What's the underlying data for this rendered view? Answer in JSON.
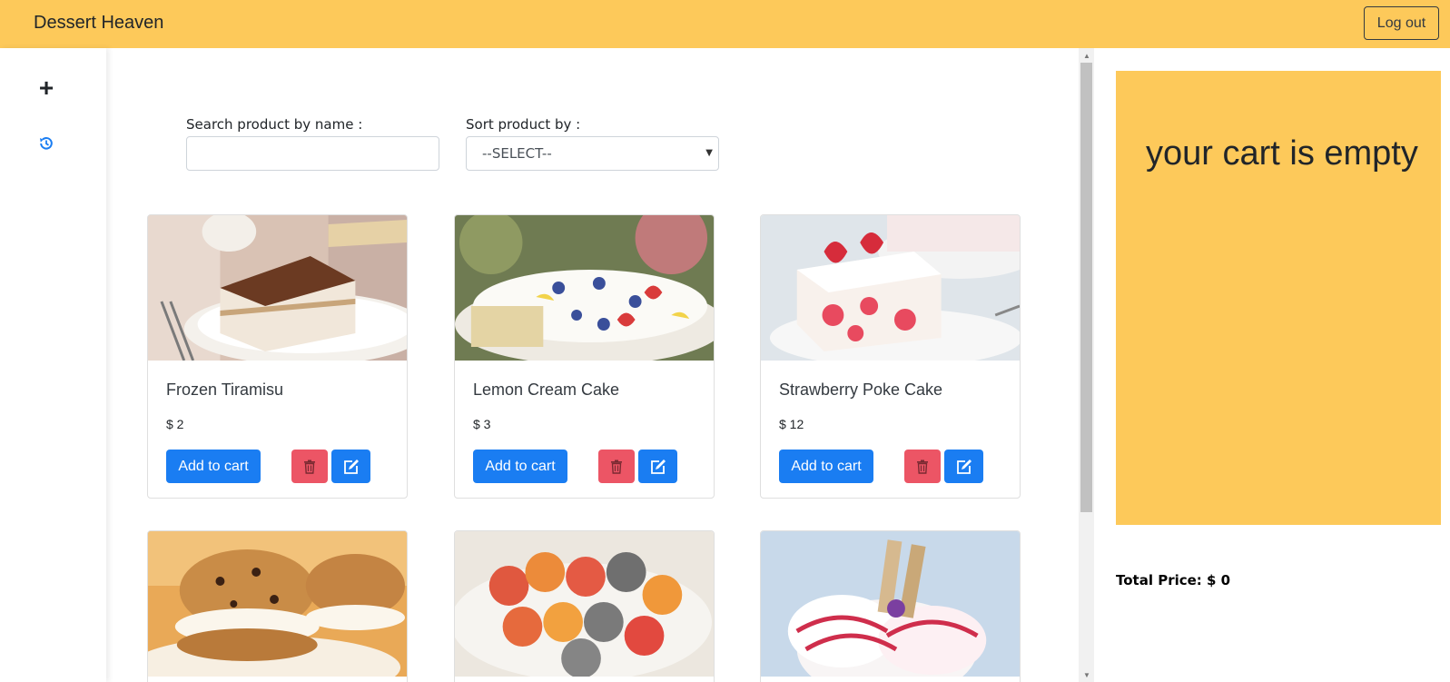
{
  "app": {
    "brand": "Dessert Heaven",
    "logout_label": "Log out"
  },
  "sidebar": {
    "items": [
      {
        "icon": "plus-icon",
        "label": "+"
      },
      {
        "icon": "history-icon"
      }
    ]
  },
  "filters": {
    "search_label": "Search product by name :",
    "search_value": "",
    "sort_label": "Sort product by :",
    "sort_selected": "--SELECT--"
  },
  "products": [
    {
      "name": "Frozen Tiramisu",
      "price": "$ 2",
      "add_label": "Add to cart"
    },
    {
      "name": "Lemon Cream Cake",
      "price": "$ 3",
      "add_label": "Add to cart"
    },
    {
      "name": "Strawberry Poke Cake",
      "price": "$ 12",
      "add_label": "Add to cart"
    },
    {
      "name": "",
      "price": "",
      "add_label": ""
    },
    {
      "name": "",
      "price": "",
      "add_label": ""
    },
    {
      "name": "",
      "price": "",
      "add_label": ""
    }
  ],
  "cart": {
    "empty_message": "your cart is empty",
    "total_label": "Total Price: $ 0"
  },
  "colors": {
    "accent": "#fdc95a",
    "primary": "#1a7df2",
    "danger": "#ec5565"
  }
}
